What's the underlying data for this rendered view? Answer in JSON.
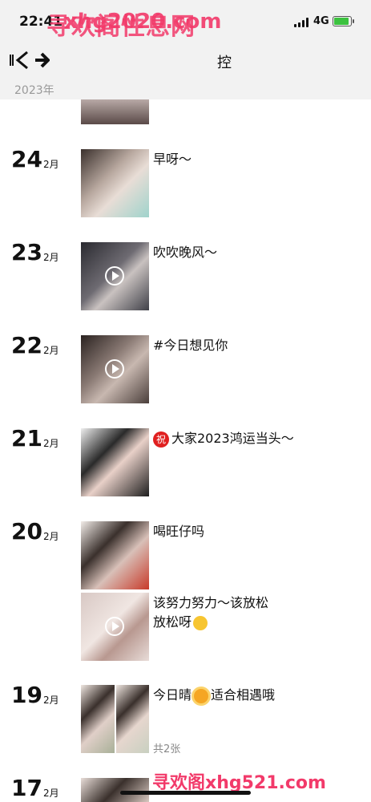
{
  "status": {
    "time": "22:41",
    "network": "4G"
  },
  "watermarks": {
    "top": "寻欢阁性息网",
    "url": "xhg2020.com",
    "bottom": "寻欢阁xhg521.com"
  },
  "navbar": {
    "title": "控"
  },
  "year_label": "2023年",
  "month_label": "2月",
  "posts": [
    {
      "day": "24",
      "caption": "早呀～"
    },
    {
      "day": "23",
      "caption": "吹吹晚风～"
    },
    {
      "day": "22",
      "caption": "#今日想见你"
    },
    {
      "day": "21",
      "badge": "祝",
      "caption": "大家2023鸿运当头～"
    },
    {
      "day": "20",
      "caption": "喝旺仔吗",
      "caption2a": "该努力努力～该放松",
      "caption2b": "放松呀"
    },
    {
      "day": "19",
      "caption_a": "今日晴",
      "caption_b": "适合相遇哦",
      "count": "共2张"
    },
    {
      "day": "17"
    }
  ]
}
